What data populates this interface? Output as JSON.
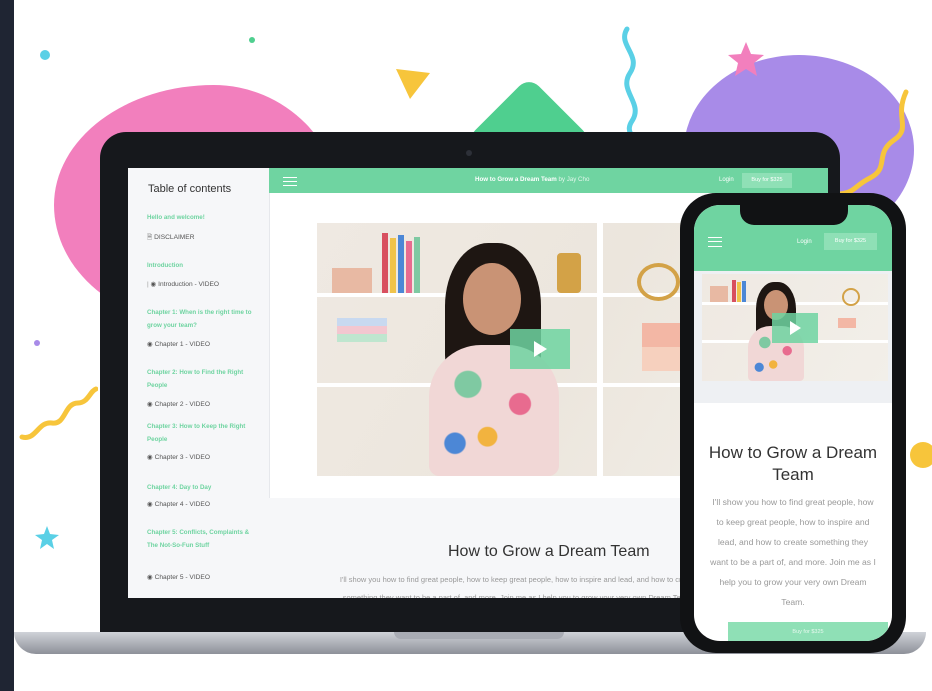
{
  "colors": {
    "accent": "#6fd4a1",
    "accent_light": "#8fe0b6",
    "pink": "#f27fbd",
    "purple": "#a88be8",
    "yellow": "#f7c53b",
    "cyan": "#5ad0e6"
  },
  "laptop": {
    "toc": {
      "title": "Table of contents",
      "sections": [
        {
          "title": "Hello and welcome!",
          "item": "DISCLAIMER",
          "item_icon": "document-icon"
        },
        {
          "title": "Introduction",
          "item": "Introduction - VIDEO",
          "item_icon": "play-circle-icon"
        },
        {
          "title": "Chapter 1: When is the right time to grow your team?",
          "item": "Chapter 1 - VIDEO",
          "item_icon": "play-circle-icon"
        },
        {
          "title": "Chapter 2: How to Find the Right People",
          "item": "Chapter 2 - VIDEO",
          "item_icon": "play-circle-icon"
        },
        {
          "title": "Chapter 3: How to Keep the Right People",
          "item": "Chapter 3 - VIDEO",
          "item_icon": "play-circle-icon"
        },
        {
          "title": "Chapter 4: Day to Day",
          "item": "Chapter 4 - VIDEO",
          "item_icon": "play-circle-icon"
        },
        {
          "title": "Chapter 5: Conflicts, Complaints & The Not-So-Fun Stuff",
          "item": "Chapter 5 - VIDEO",
          "item_icon": "play-circle-icon"
        }
      ]
    },
    "header": {
      "course_title": "How to Grow a Dream Team",
      "by_text": "by Jay Cho",
      "login": "Login",
      "buy": "Buy for $325"
    },
    "content": {
      "title": "How to Grow a Dream Team",
      "description": "I'll show you how to find great people, how to keep great people, how to inspire and lead, and how to create something they want to be a part of, and more. Join me as I help you to grow your very own Dream Team."
    }
  },
  "phone": {
    "header": {
      "login": "Login",
      "buy": "Buy for $325"
    },
    "content": {
      "title": "How to Grow a Dream Team",
      "description": "I'll show you how to find great people, how to keep great people, how to inspire and lead, and how to create something they want to be a part of, and more. Join me as I help you to grow your very own Dream Team.",
      "cta": "Buy for $325"
    }
  }
}
